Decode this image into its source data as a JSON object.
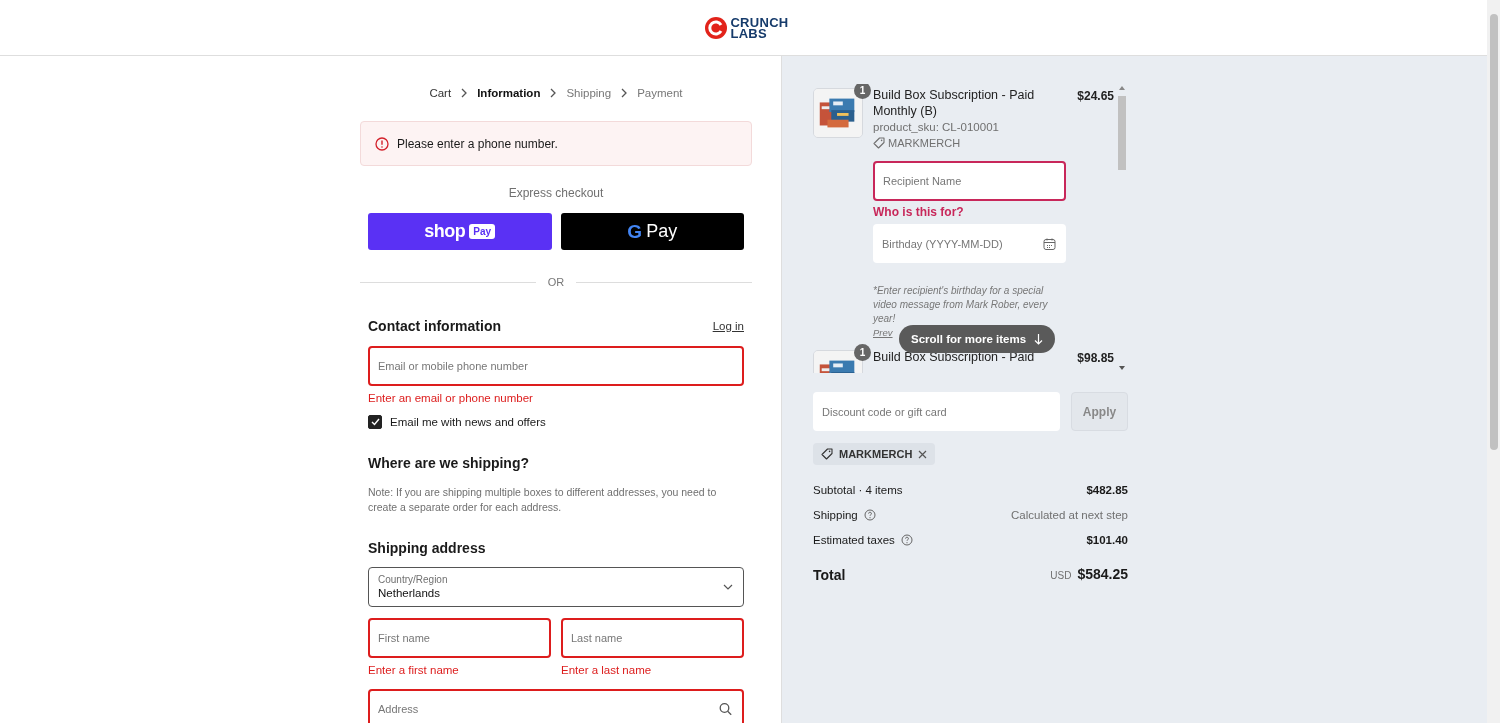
{
  "header": {
    "logo": {
      "line1": "CRUNCH",
      "line2": "LABS"
    }
  },
  "breadcrumbs": [
    {
      "label": "Cart",
      "selected": false
    },
    {
      "label": "Information",
      "selected": true
    },
    {
      "label": "Shipping",
      "selected": false
    },
    {
      "label": "Payment",
      "selected": false
    }
  ],
  "alert": {
    "message": "Please enter a phone number."
  },
  "express": {
    "title": "Express checkout",
    "buttons": [
      {
        "kind": "shop_pay",
        "label": "shop",
        "badge": "Pay"
      },
      {
        "kind": "google_pay",
        "mark": "G",
        "label": "Pay"
      }
    ]
  },
  "divider": "OR",
  "contact": {
    "title": "Contact information",
    "login": "Log in",
    "field": {
      "placeholder": "Email or mobile phone number",
      "invalid": true
    },
    "error": "Enter an email or phone number",
    "newsletter": {
      "label": "Email me with news and offers",
      "checked": true
    }
  },
  "shipping_note": {
    "title": "Where are we shipping?",
    "text": "Note: If you are shipping multiple boxes to different addresses, you need to create a separate order for each address."
  },
  "shipping_address": {
    "title": "Shipping address",
    "rows": [
      [
        {
          "kind": "select",
          "label": "Country/Region",
          "value": "Netherlands",
          "invalid": false
        }
      ],
      [
        {
          "kind": "text",
          "placeholder": "First name",
          "invalid": true,
          "error": "Enter a first name"
        },
        {
          "kind": "text",
          "placeholder": "Last name",
          "invalid": true,
          "error": "Enter a last name"
        }
      ],
      [
        {
          "kind": "search",
          "placeholder": "Address",
          "invalid": true
        }
      ]
    ]
  },
  "cart": {
    "items": [
      {
        "quantity": "1",
        "title": "Build Box Subscription - Paid Monthly (B)",
        "price": "$24.65",
        "sku": "product_sku: CL-010001",
        "discount": "MARKMERCH",
        "recipient": {
          "placeholder": "Recipient Name",
          "invalid": true,
          "hint": "Who is this for?"
        },
        "birthday": {
          "placeholder": "Birthday (YYYY-MM-DD)"
        },
        "note": "*Enter recipient's birthday for a special video message from Mark Rober, every year!",
        "link": "Prev"
      },
      {
        "quantity": "1",
        "title": "Build Box Subscription - Paid",
        "price": "$98.85"
      }
    ],
    "scroll_hint": "Scroll for more items"
  },
  "discount": {
    "placeholder": "Discount code or gift card",
    "button": "Apply",
    "disabled": true
  },
  "applied_codes": [
    {
      "code": "MARKMERCH"
    }
  ],
  "summary": [
    {
      "label": "Subtotal · 4 items",
      "value": "$482.85",
      "info": false,
      "muted": false
    },
    {
      "label": "Shipping",
      "value": "Calculated at next step",
      "info": true,
      "muted": true
    },
    {
      "label": "Estimated taxes",
      "value": "$101.40",
      "info": true,
      "muted": false
    }
  ],
  "total": {
    "label": "Total",
    "currency": "USD",
    "amount": "$584.25"
  }
}
